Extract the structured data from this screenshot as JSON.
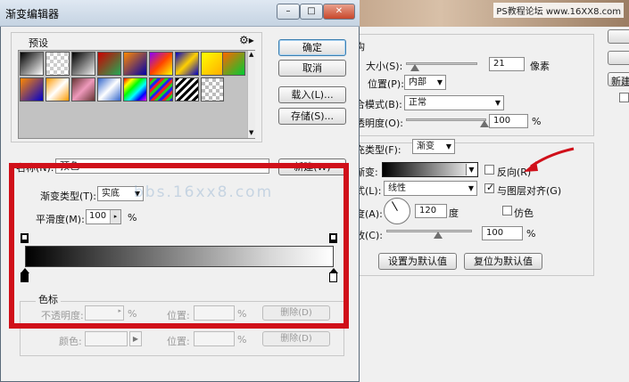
{
  "watermark_top": "PS教程论坛 www.16XX8.com",
  "watermark_faint": "bbs.16xx8.com",
  "gradient_editor": {
    "title": "渐变编辑器",
    "presets_label": "预设",
    "buttons": {
      "ok": "确定",
      "cancel": "取消",
      "load": "载入(L)...",
      "save": "存储(S)...",
      "new": "新建(W)"
    },
    "name_label": "名称(N):",
    "name_value": "预色",
    "gradient_type_label": "渐变类型(T):",
    "gradient_type_value": "实底",
    "smoothness_label": "平滑度(M):",
    "smoothness_value": "100",
    "percent": "%",
    "color_stops_label": "色标",
    "opacity_label": "不透明度:",
    "location_label": "位置:",
    "delete_label": "删除(D)",
    "color_label": "颜色:"
  },
  "layer_style": {
    "structure_label": "构",
    "size_label": "大小(S):",
    "size_value": "21",
    "size_unit": "像素",
    "position_label": "位置(P):",
    "position_value": "内部",
    "blend_label": "合模式(B):",
    "blend_value": "正常",
    "opacity_label": "透明度(O):",
    "opacity_value": "100",
    "fill_type_label": "充类型(F):",
    "fill_type_value": "渐变",
    "gradient_label": "渐变:",
    "reverse_label": "反向(R)",
    "style_label": "式(L):",
    "style_value": "线性",
    "align_label": "与图层对齐(G)",
    "angle_label": "度(A):",
    "angle_value": "120",
    "angle_unit": "度",
    "dither_label": "仿色",
    "scale_label": "放(C):",
    "scale_value": "100",
    "set_default": "设置为默认值",
    "reset_default": "复位为默认值",
    "new_style_label": "新建"
  }
}
